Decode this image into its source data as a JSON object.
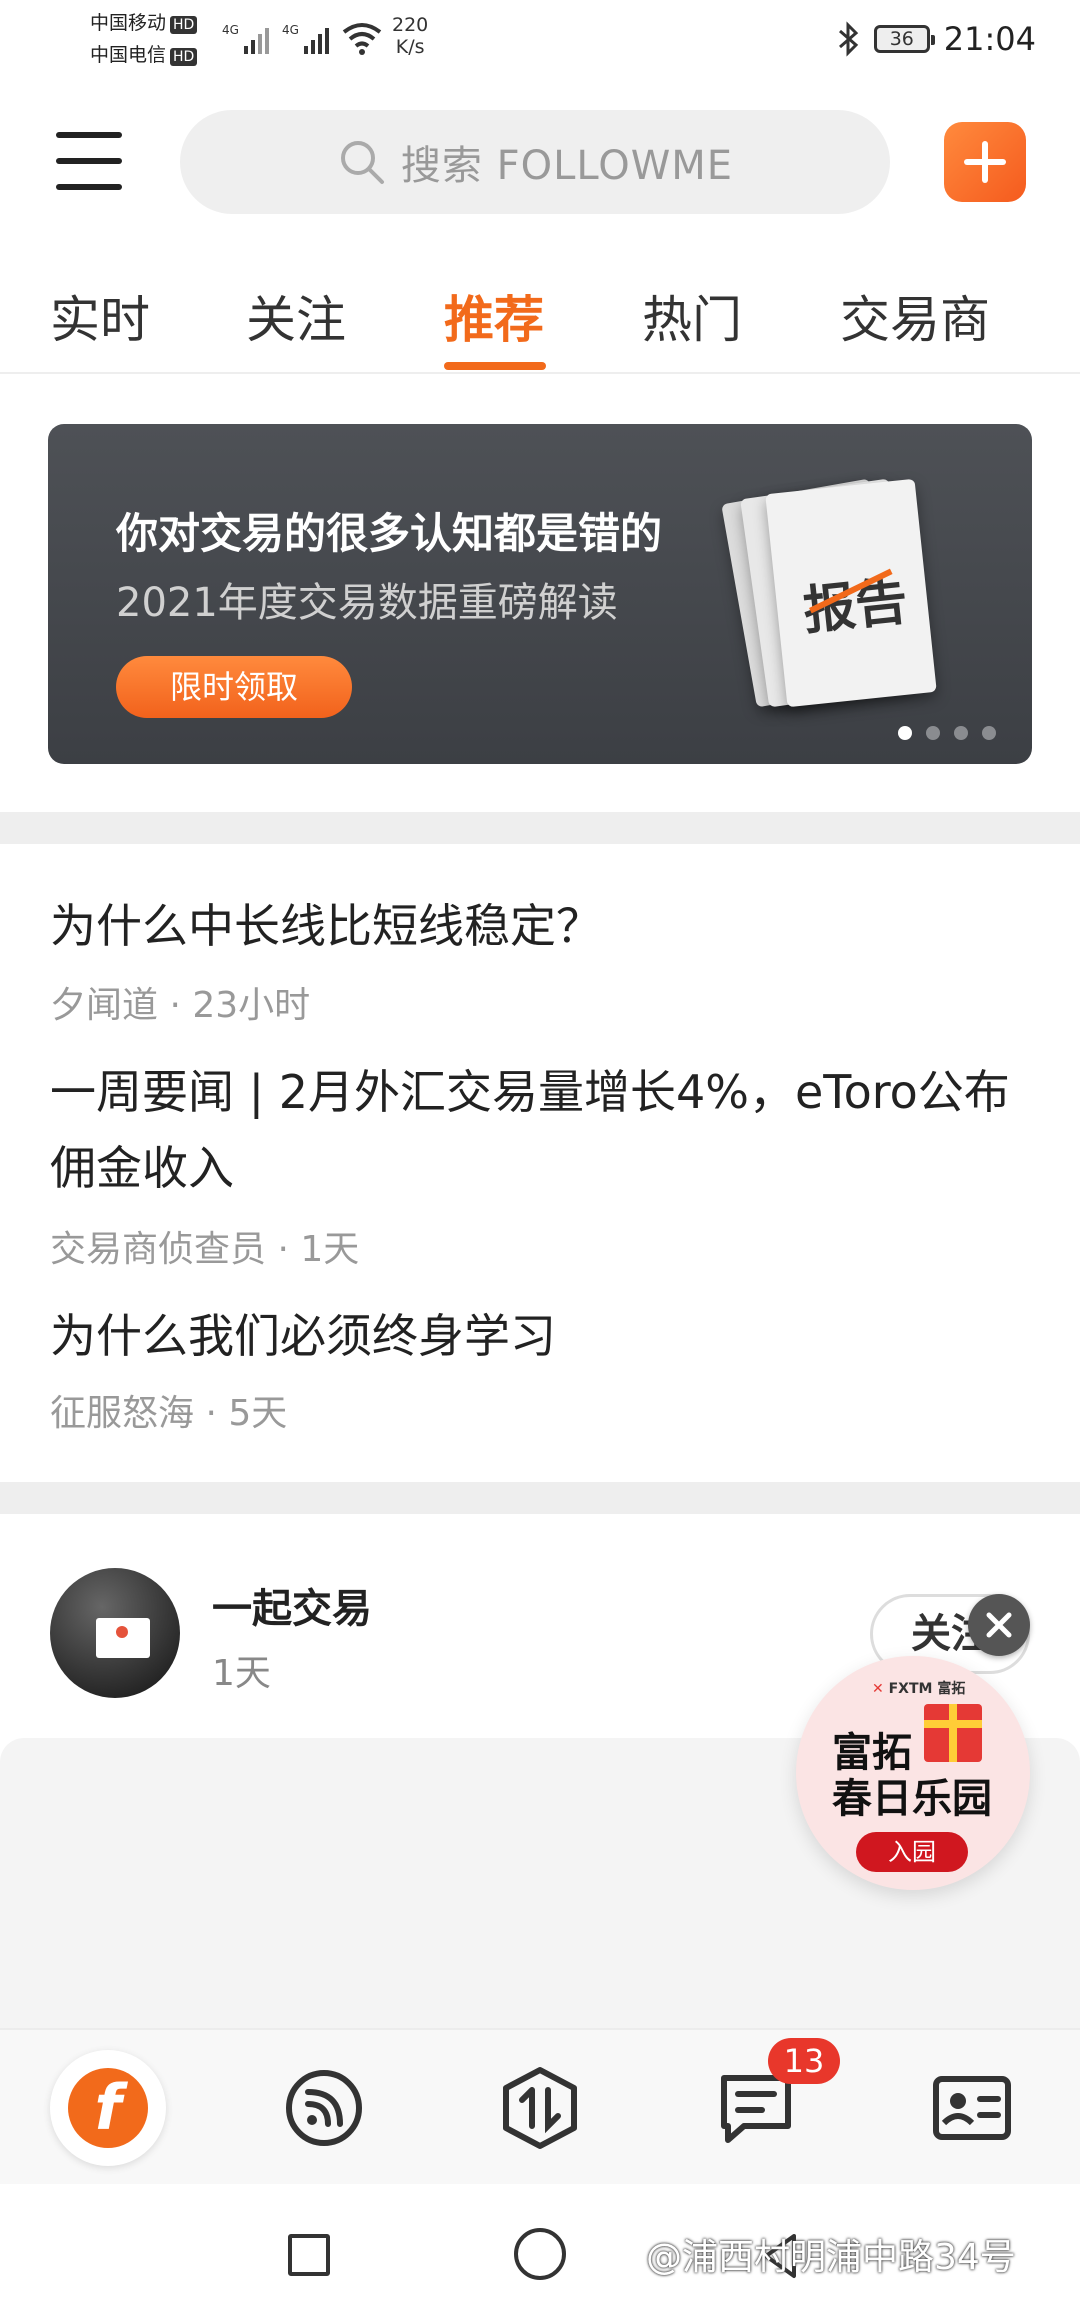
{
  "status_bar": {
    "carrier_1": "中国移动",
    "carrier_2": "中国电信",
    "hd": "HD",
    "network_1": "4G",
    "network_2": "4G",
    "net_speed_value": "220",
    "net_speed_unit": "K/s",
    "battery": "36",
    "time": "21:04"
  },
  "top_bar": {
    "search_placeholder": "搜索 FOLLOWME"
  },
  "tabs": [
    {
      "label": "实时"
    },
    {
      "label": "关注"
    },
    {
      "label": "推荐",
      "active": true
    },
    {
      "label": "热门"
    },
    {
      "label": "交易商"
    }
  ],
  "banner": {
    "title": "你对交易的很多认知都是错的",
    "subtitle": "2021年度交易数据重磅解读",
    "button": "限时领取",
    "book_word": "报告",
    "page_index": 0,
    "page_count": 4
  },
  "news": [
    {
      "title": "为什么中长线比短线稳定？",
      "author": "夕闻道",
      "time": "23小时"
    },
    {
      "title": "一周要闻 | 2月外汇交易量增长4%，eToro公布佣金收入",
      "author": "交易商侦查员",
      "time": "1天"
    },
    {
      "title": "为什么我们必须终身学习",
      "author": "征服怒海",
      "time": "5天"
    }
  ],
  "meta_separator": " · ",
  "post": {
    "user_name": "一起交易",
    "time": "1天",
    "follow_label": "关注"
  },
  "promo": {
    "brand": "FXTM 富拓",
    "line1": "富拓",
    "line2": "春日乐园",
    "button": "入园"
  },
  "bottom_nav": {
    "items": [
      {
        "name": "home",
        "icon": "followme-logo-icon"
      },
      {
        "name": "feed",
        "icon": "rss-icon"
      },
      {
        "name": "trade",
        "icon": "trade-arrows-icon"
      },
      {
        "name": "messages",
        "icon": "message-icon",
        "badge": "13"
      },
      {
        "name": "profile",
        "icon": "id-card-icon"
      }
    ]
  },
  "watermark": "@浦西村明浦中路34号",
  "colors": {
    "accent": "#f26a1b",
    "badge": "#e8372b",
    "banner_bg": "#45484d"
  }
}
